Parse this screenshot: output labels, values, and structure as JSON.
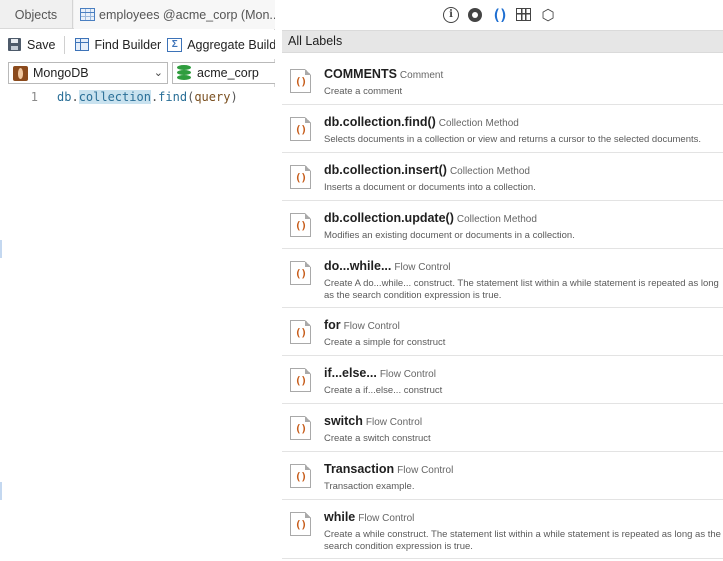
{
  "tabs": {
    "objects": "Objects",
    "document": "employees @acme_corp (Mon..."
  },
  "toolbar": {
    "save": "Save",
    "find_builder": "Find Builder",
    "aggregate_builder": "Aggregate Build"
  },
  "connection": {
    "database_type": "MongoDB",
    "schema": "acme_corp"
  },
  "editor": {
    "line_number": "1",
    "code": {
      "db": "db",
      "dot1": ".",
      "collection": "collection",
      "dot2": ".",
      "method": "find",
      "open": "(",
      "arg": "query",
      "close": ")"
    }
  },
  "snippet_panel": {
    "icon_bar": [
      "info-icon",
      "eye-icon",
      "snippet-icon",
      "columns-icon",
      "hexagon-icon"
    ],
    "header": "All Labels",
    "snippet_glyph": "()",
    "items": [
      {
        "name": "COMMENTS",
        "category": "Comment",
        "description": "Create a comment"
      },
      {
        "name": "db.collection.find()",
        "category": "Collection Method",
        "description": "Selects documents in a collection or view and returns a cursor to the selected documents."
      },
      {
        "name": "db.collection.insert()",
        "category": "Collection Method",
        "description": "Inserts a document or documents into a collection."
      },
      {
        "name": "db.collection.update()",
        "category": "Collection Method",
        "description": "Modifies an existing document or documents in a collection."
      },
      {
        "name": "do...while...",
        "category": "Flow Control",
        "description": "Create A do...while... construct. The statement list within a while statement is repeated as long as the search condition expression is true."
      },
      {
        "name": "for",
        "category": "Flow Control",
        "description": "Create a simple for construct"
      },
      {
        "name": "if...else...",
        "category": "Flow Control",
        "description": "Create a if...else... construct"
      },
      {
        "name": "switch",
        "category": "Flow Control",
        "description": "Create a switch construct"
      },
      {
        "name": "Transaction",
        "category": "Flow Control",
        "description": "Transaction example."
      },
      {
        "name": "while",
        "category": "Flow Control",
        "description": "Create a while construct. The statement list within a while statement is repeated as long as the search condition expression is true."
      }
    ]
  }
}
